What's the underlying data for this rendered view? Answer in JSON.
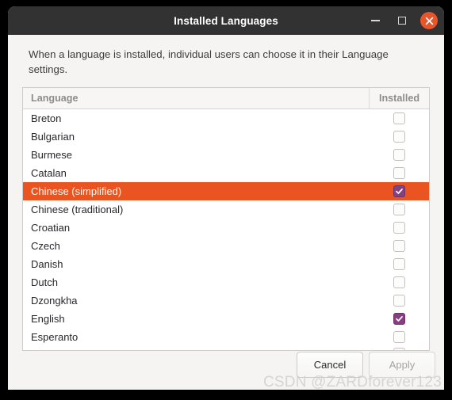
{
  "window": {
    "title": "Installed Languages",
    "controls": {
      "minimize": "minimize",
      "maximize": "maximize",
      "close": "close"
    },
    "accent_color": "#e95420",
    "titlebar_color": "#323232",
    "checked_color": "#87407f"
  },
  "description": "When a language is installed, individual users can choose it in their Language settings.",
  "table": {
    "columns": [
      "Language",
      "Installed"
    ],
    "rows": [
      {
        "language": "Breton",
        "installed": false,
        "selected": false
      },
      {
        "language": "Bulgarian",
        "installed": false,
        "selected": false
      },
      {
        "language": "Burmese",
        "installed": false,
        "selected": false
      },
      {
        "language": "Catalan",
        "installed": false,
        "selected": false
      },
      {
        "language": "Chinese (simplified)",
        "installed": true,
        "selected": true
      },
      {
        "language": "Chinese (traditional)",
        "installed": false,
        "selected": false
      },
      {
        "language": "Croatian",
        "installed": false,
        "selected": false
      },
      {
        "language": "Czech",
        "installed": false,
        "selected": false
      },
      {
        "language": "Danish",
        "installed": false,
        "selected": false
      },
      {
        "language": "Dutch",
        "installed": false,
        "selected": false
      },
      {
        "language": "Dzongkha",
        "installed": false,
        "selected": false
      },
      {
        "language": "English",
        "installed": true,
        "selected": false
      },
      {
        "language": "Esperanto",
        "installed": false,
        "selected": false
      },
      {
        "language": "",
        "installed": false,
        "selected": false,
        "partial": true
      }
    ]
  },
  "buttons": {
    "cancel": "Cancel",
    "apply": "Apply",
    "apply_disabled": true
  },
  "watermark": "CSDN @ZARDforever123"
}
